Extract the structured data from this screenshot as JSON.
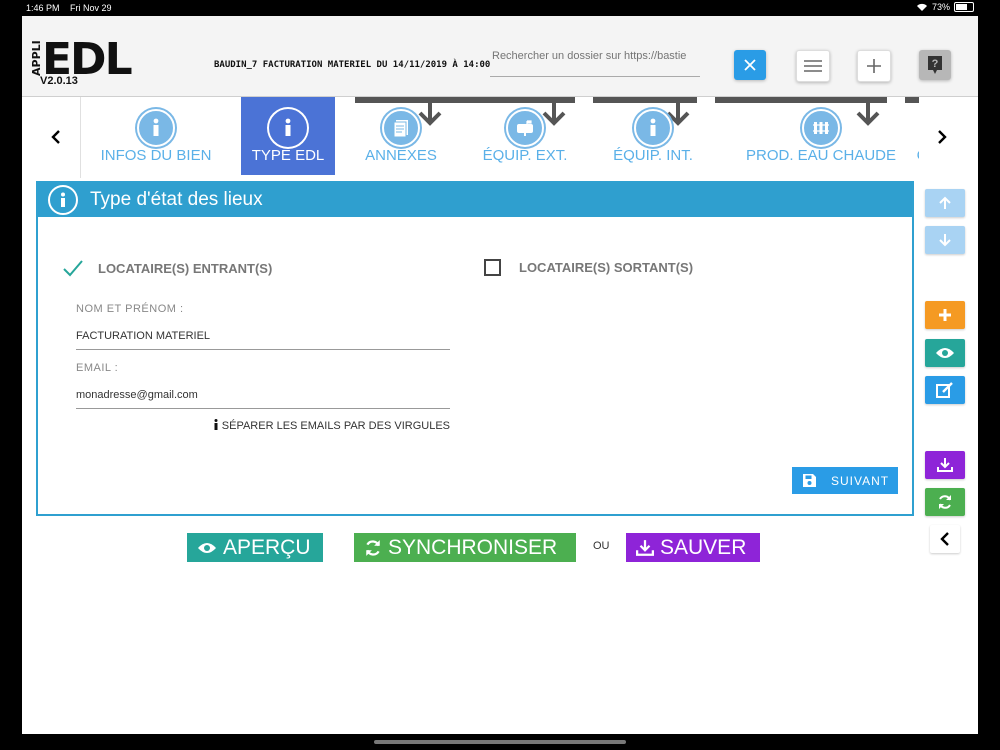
{
  "status": {
    "time": "1:46 PM",
    "date": "Fri Nov 29",
    "battery": "73%"
  },
  "app": {
    "logo_appli": "APPLI",
    "logo_edl": "EDL",
    "version": "V2.0.13"
  },
  "header": {
    "folder_title": "BAUDIN_7 FACTURATION MATERIEL DU 14/11/2019 À 14:00",
    "search_placeholder": "Rechercher un dossier sur https://bastie"
  },
  "tabs": [
    {
      "label": "INFOS DU BIEN",
      "icon": "info-icon",
      "active": false
    },
    {
      "label": "TYPE EDL",
      "icon": "info-icon",
      "active": true
    },
    {
      "label": "ANNEXES",
      "icon": "document-icon",
      "active": false
    },
    {
      "label": "ÉQUIP. EXT.",
      "icon": "mailbox-icon",
      "active": false
    },
    {
      "label": "ÉQUIP. INT.",
      "icon": "info-icon",
      "active": false
    },
    {
      "label": "PROD. EAU CHAUDE",
      "icon": "radiator-icon",
      "active": false
    },
    {
      "label": "C",
      "icon": "info-icon",
      "active": false
    }
  ],
  "panel": {
    "title": "Type d'état des lieux",
    "option_in": "LOCATAIRE(S) ENTRANT(S)",
    "option_in_checked": true,
    "option_out": "LOCATAIRE(S) SORTANT(S)",
    "option_out_checked": false,
    "name_label": "NOM ET PRÉNOM :",
    "name_value": "FACTURATION MATERIEL",
    "email_label": "EMAIL :",
    "email_value": "monadresse@gmail.com",
    "email_hint": "SÉPARER LES EMAILS PAR DES VIRGULES",
    "next_button": "SUIVANT"
  },
  "bottom": {
    "preview": "APERÇU",
    "sync": "SYNCHRONISER",
    "or": "OU",
    "save": "SAUVER"
  },
  "colors": {
    "accent_blue": "#2a9ce6",
    "panel_blue": "#2f9fcf",
    "active_tab": "#4b73d6",
    "teal": "#26a69a",
    "green": "#4caf50",
    "purple": "#8e24d8",
    "orange": "#f59a23"
  }
}
